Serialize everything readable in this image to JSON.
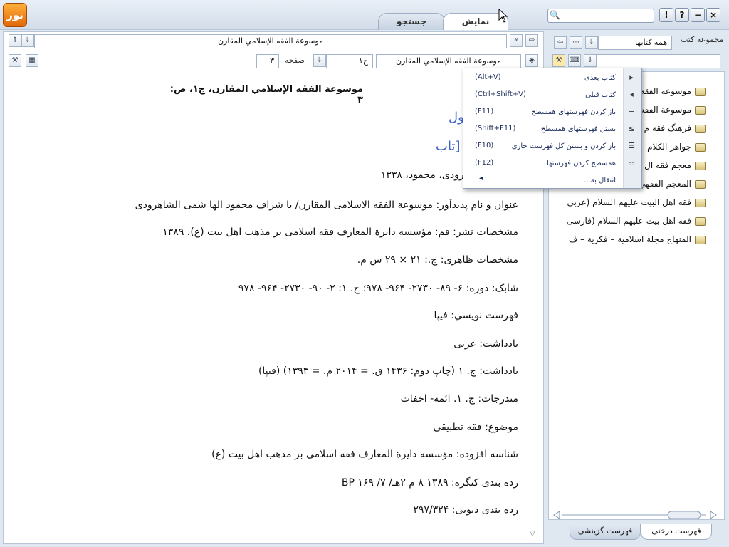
{
  "app": {
    "logo_text": "نور"
  },
  "tabs": {
    "display": "نمایش",
    "search": "جستجو"
  },
  "window": {
    "help": "?",
    "info": "!",
    "minimize": "−",
    "close": "×"
  },
  "book_title_field": "موسوعة الفقه الإسلامي المقارن",
  "nav": {
    "book_field": "موسوعة الفقه الإسلامي المقارن",
    "volume_value": "ج۱",
    "page_label": "صفحه",
    "page_value": "۳"
  },
  "doc": {
    "header": "موسوعة الفقه الإسلامي المقارن، ج۱، ص: ۳",
    "blue_line1": "ول",
    "blue_line2": "تاب]",
    "lines": [
      "ها شمی شاهرودی، محمود، ۱۳۳۸",
      "عنوان و نام پدیدآور: موسوعة الفقه الاسلامی المقارن/ با شراف محمود الها شمی الشاهرودی",
      "مشخصات نشر: قم: مؤسسه دایرة المعارف فقه اسلامی بر مذهب اهل بیت (ع)، ۱۳۸۹",
      "مشخصات ظاهری: ج.: ۲۱ × ۲۹ س م.",
      "شابک: دوره: ۶- ۸۹- ۲۷۳۰- ۹۶۴- ۹۷۸؛ ج. ۱: ۲- ۹۰- ۲۷۳۰- ۹۶۴- ۹۷۸",
      "فهرست نويسي: فيپا",
      "يادداشت: عربی",
      "يادداشت: ج. ۱ (چاپ دوم: ۱۴۳۶ ق. = ۲۰۱۴ م. = ۱۳۹۳) (فيپا)",
      "مندرجات: ج. ۱. ائمه- اخفات",
      "موضوع: فقه تطبیقی",
      "شناسه افزوده: مؤسسه دایرة المعارف فقه اسلامی بر مذهب اهل بیت (ع)",
      "رده بندی کنگره: ۱۳۸۹ ۸ م ۲هـ/ ۷/ ۱۶۹ BP",
      "رده بندی دیویی: ۲۹۷/۳۲۴"
    ]
  },
  "right": {
    "set_label": "مجموعه کتب",
    "set_value": "همه کتابها",
    "tree": [
      "موسوعة الفقه",
      "موسوعة الفقه",
      "فرهنگ فقه م",
      "جواهر الكلام",
      "معجم فقه ال",
      "المعجم الفقهي",
      "فقه اهل البیت علیهم السلام (عربی",
      "فقه اهل بیت علیهم السلام (فارسی",
      "المنهاج مجلة اسلامية – فكرية – ف"
    ],
    "bottom_tabs": {
      "tree": "فهرست درختی",
      "selective": "فهرست گزینشی"
    }
  },
  "context_menu": [
    {
      "label": "کتاب بعدی",
      "shortcut": "(Alt+V)",
      "icon": "next-book-icon"
    },
    {
      "label": "کتاب قبلی",
      "shortcut": "(Ctrl+Shift+V)",
      "icon": "prev-book-icon"
    },
    {
      "label": "باز کردن فهرستهای همسطح",
      "shortcut": "(F11)",
      "icon": "expand-level-icon"
    },
    {
      "label": "بستن فهرستهای همسطح",
      "shortcut": "(Shift+F11)",
      "icon": "collapse-level-icon"
    },
    {
      "label": "باز کردن و بستن کل فهرست جاری",
      "shortcut": "(F10)",
      "icon": "toggle-all-icon"
    },
    {
      "label": "همسطح کردن فهرستها",
      "shortcut": "(F12)",
      "icon": "level-icon"
    },
    {
      "label": "انتقال به...",
      "shortcut": "",
      "icon": ""
    }
  ]
}
